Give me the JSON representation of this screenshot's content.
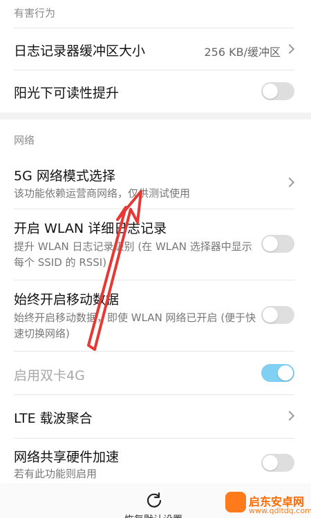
{
  "sections": {
    "harmful": "有害行为",
    "network": "网络"
  },
  "rows": {
    "logger_buffer": {
      "title": "日志记录器缓冲区大小",
      "value": "256 KB/缓冲区"
    },
    "sunlight": {
      "title": "阳光下可读性提升",
      "toggle": false
    },
    "mode_5g": {
      "title": "5G 网络模式选择",
      "subtitle": "该功能依赖运营商网络，仅供测试使用"
    },
    "wlan_log": {
      "title": "开启 WLAN 详细日志记录",
      "subtitle": "提升 WLAN 日志记录级别 (在 WLAN 选择器中显示每个 SSID 的 RSSI)",
      "toggle": false
    },
    "mobile_data": {
      "title": "始终开启移动数据",
      "subtitle": "始终开启移动数据，即使 WLAN 网络已开启 (便于快速切换网络)",
      "toggle": false
    },
    "dual_4g": {
      "title": "启用双卡4G",
      "toggle": true,
      "enabled": false
    },
    "lte_ca": {
      "title": "LTE 载波聚合"
    },
    "tether_hw": {
      "title": "网络共享硬件加速",
      "subtitle": "若有此功能则启用",
      "toggle": false
    }
  },
  "bottom": {
    "reset_label": "恢复默认设置"
  },
  "watermark": {
    "name": "启东安卓网",
    "url": "www.qdltdq.com"
  },
  "colors": {
    "toggle_on": "#7fd0f2",
    "toggle_off": "#dedede",
    "annotation_arrow": "#e53935"
  }
}
